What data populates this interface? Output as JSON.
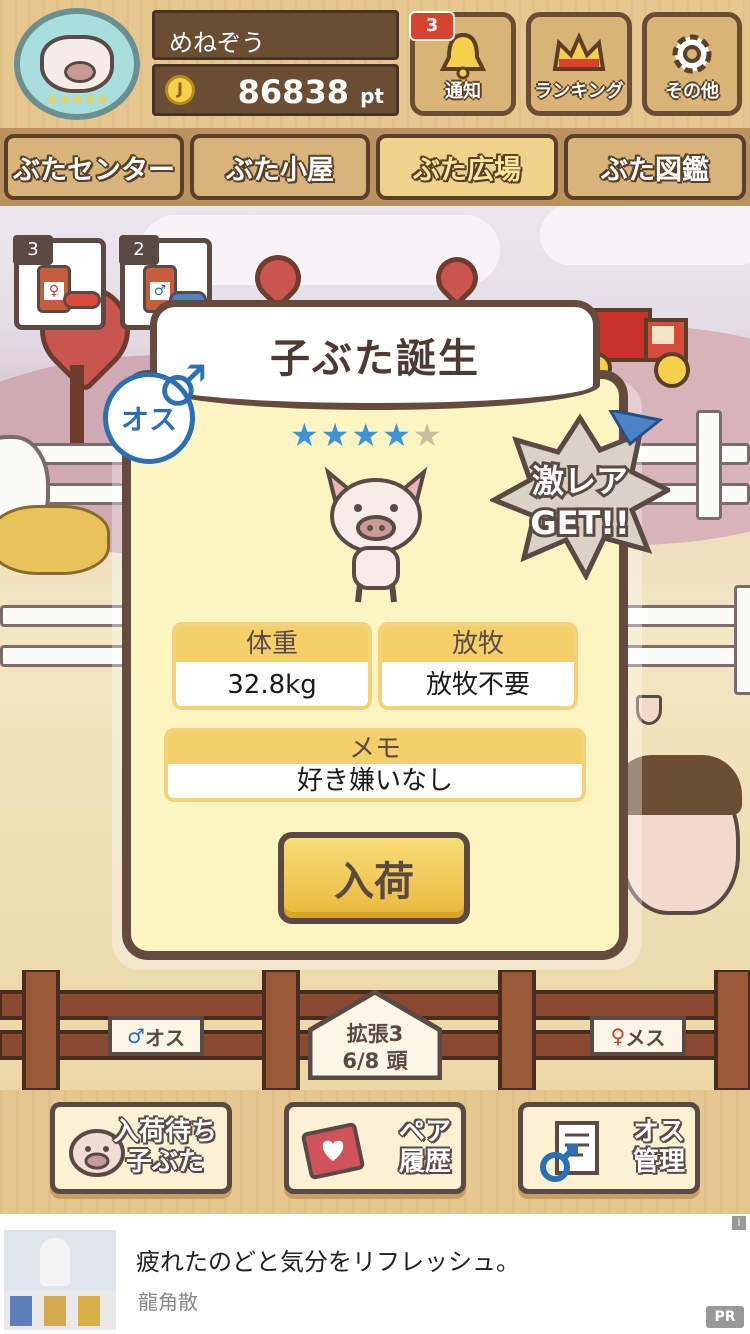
{
  "header": {
    "username": "めねぞう",
    "coin_symbol": "J",
    "points": "86838",
    "points_unit": "pt",
    "notification_count": "3",
    "buttons": {
      "notify": "通知",
      "ranking": "ランキング",
      "other": "その他"
    },
    "avatar_stars": "★★★★★"
  },
  "tabs": [
    {
      "label": "ぶたセンター",
      "active": false
    },
    {
      "label": "ぶた小屋",
      "active": false
    },
    {
      "label": "ぶた広場",
      "active": true
    },
    {
      "label": "ぶた図鑑",
      "active": false
    }
  ],
  "items": [
    {
      "count": "3",
      "symbol": "♀"
    },
    {
      "count": "2",
      "symbol": "♂"
    }
  ],
  "modal": {
    "title": "子ぶた誕生",
    "sex_label": "オス",
    "sex_symbol": "♂",
    "stars_on": "★★★★",
    "stars_off": "★",
    "rarity_rating": 4,
    "rarity_max": 5,
    "rare_badge_line1": "激レア",
    "rare_badge_line2": "GET!!",
    "weight_label": "体重",
    "weight_value": "32.8kg",
    "graze_label": "放牧",
    "graze_value": "放牧不要",
    "memo_label": "メモ",
    "memo_value": "好き嫌いなし",
    "action_label": "入荷"
  },
  "fence": {
    "male_symbol": "♂",
    "male_label": "オス",
    "female_symbol": "♀",
    "female_label": "メス",
    "expansion": "拡張3",
    "capacity": "6/8 頭"
  },
  "bottom_bar": {
    "waiting_line1": "入荷待ち",
    "waiting_line2": "子ぶた",
    "pair_line1": "ペア",
    "pair_line2": "履歴",
    "male_mgmt_line1": "オス",
    "male_mgmt_line2": "管理"
  },
  "ad": {
    "title": "疲れたのどと気分をリフレッシュ。",
    "advertiser": "龍角散",
    "pr_label": "PR",
    "info_label": "i"
  },
  "colors": {
    "male_blue": "#2b6fb6",
    "female_red": "#d33a2c",
    "wood_dark": "#5b4a44",
    "panel_cream": "#fdf5c1",
    "label_gold": "#f4d06a",
    "star_blue": "#3d93d8"
  }
}
